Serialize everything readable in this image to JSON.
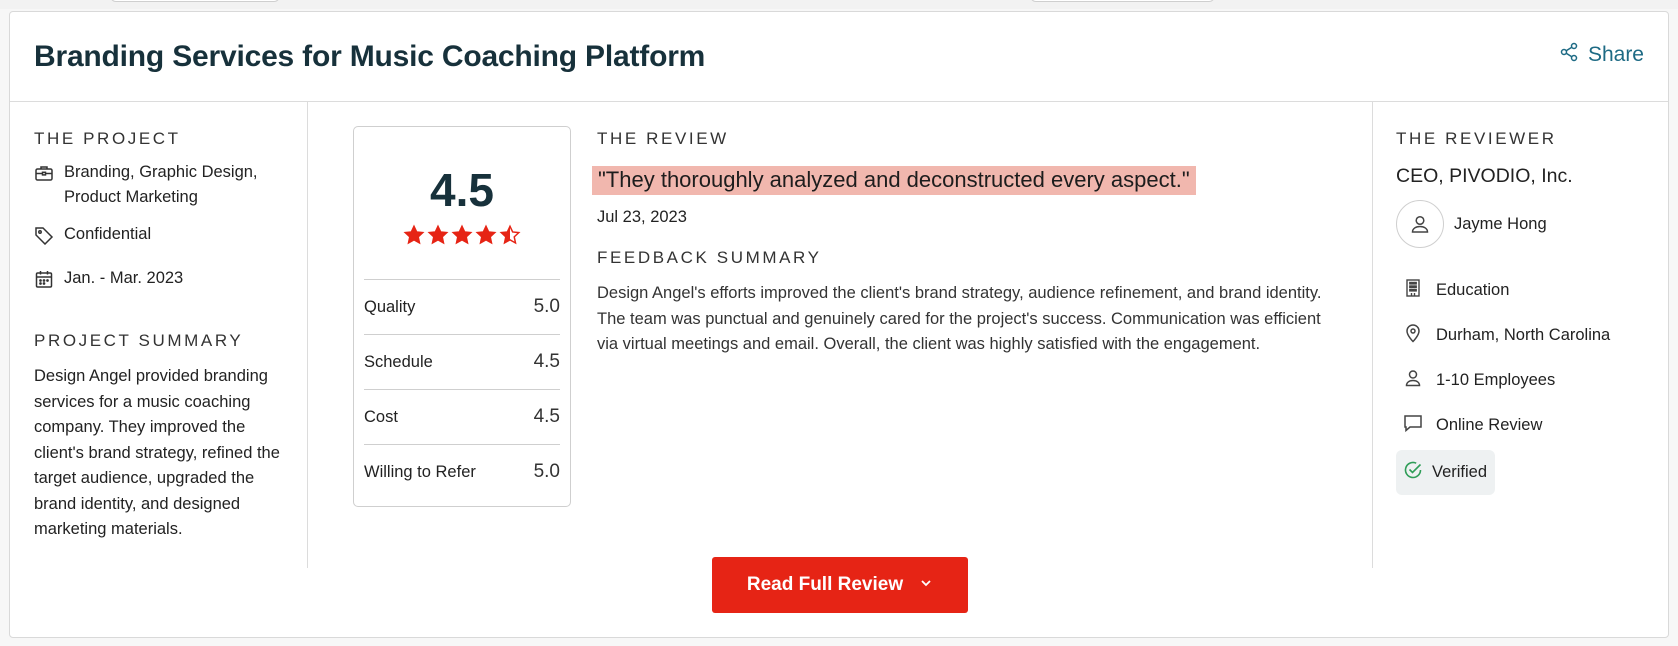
{
  "header": {
    "title": "Branding Services for Music Coaching Platform",
    "share_label": "Share"
  },
  "project": {
    "section_label": "THE PROJECT",
    "services": "Branding, Graphic Design, Product Marketing",
    "budget": "Confidential",
    "dates": "Jan. - Mar. 2023",
    "summary_label": "PROJECT SUMMARY",
    "summary": "Design Angel provided branding services for a music coaching company. They improved the client's brand strategy, refined the target audience, upgraded the brand identity, and designed marketing materials."
  },
  "ratings": {
    "overall": "4.5",
    "overall_value": 4.5,
    "rows": [
      {
        "label": "Quality",
        "value": "5.0"
      },
      {
        "label": "Schedule",
        "value": "4.5"
      },
      {
        "label": "Cost",
        "value": "4.5"
      },
      {
        "label": "Willing to Refer",
        "value": "5.0"
      }
    ]
  },
  "review": {
    "section_label": "THE REVIEW",
    "quote": "\"They thoroughly analyzed and deconstructed every aspect.\"",
    "date": "Jul 23, 2023",
    "feedback_label": "FEEDBACK SUMMARY",
    "feedback": "Design Angel's efforts improved the client's brand strategy, audience refinement, and brand identity. The team was punctual and genuinely cared for the project's success. Communication was efficient via virtual meetings and email. Overall, the client was highly satisfied with the engagement."
  },
  "reviewer": {
    "section_label": "THE REVIEWER",
    "title": "CEO, PIVODIO, Inc.",
    "name": "Jayme Hong",
    "industry": "Education",
    "location": "Durham, North Carolina",
    "size": "1-10 Employees",
    "review_type": "Online Review",
    "verified_label": "Verified"
  },
  "cta": {
    "label": "Read Full Review"
  },
  "colors": {
    "accent": "#e62415",
    "title": "#17313b",
    "share": "#1d6a84",
    "quote_highlight": "#f1b7ae",
    "verified": "#2e9d57"
  }
}
